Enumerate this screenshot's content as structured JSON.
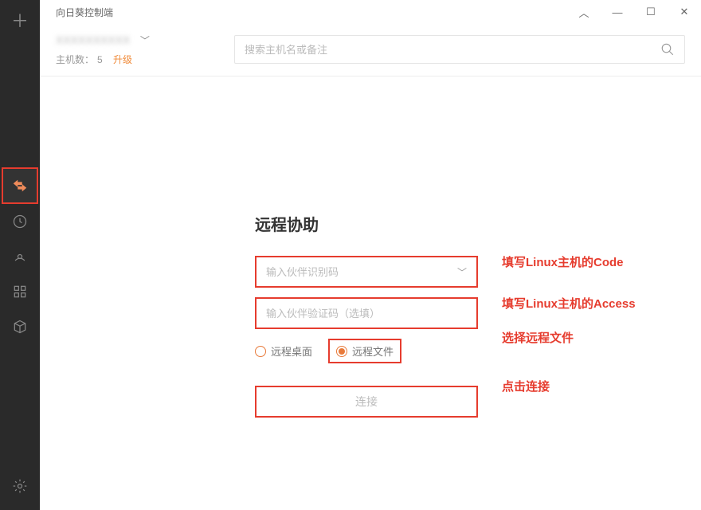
{
  "window": {
    "title": "向日葵控制端"
  },
  "account": {
    "name_masked": "XXXXXXXXXX",
    "host_label": "主机数：",
    "host_count": "5",
    "upgrade": "升级"
  },
  "search": {
    "placeholder": "搜索主机名或备注"
  },
  "remote_assist": {
    "title": "远程协助",
    "code_placeholder": "输入伙伴识别码",
    "verify_placeholder": "输入伙伴验证码（选填）",
    "radio_desktop": "远程桌面",
    "radio_file": "远程文件",
    "connect": "连接"
  },
  "annotations": {
    "a1": "填写Linux主机的Code",
    "a2": "填写Linux主机的Access",
    "a3": "选择远程文件",
    "a4": "点击连接"
  }
}
